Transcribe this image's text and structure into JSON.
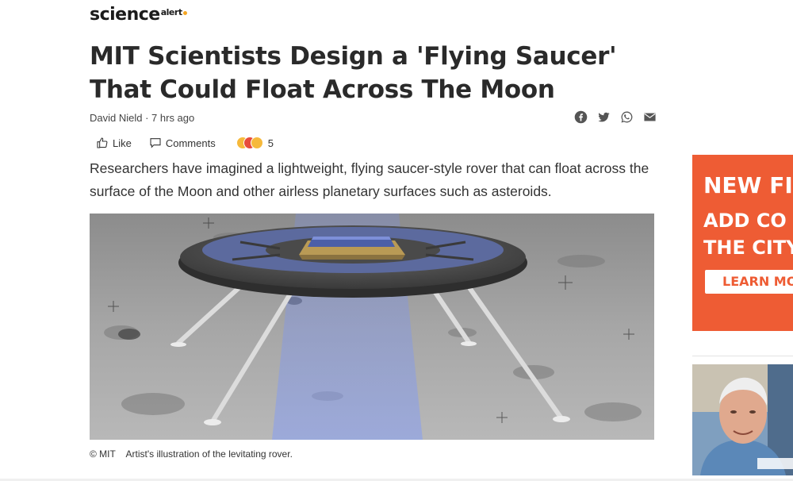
{
  "site": {
    "logo_main": "science",
    "logo_sup": "alert"
  },
  "article": {
    "title": "MIT Scientists Design a 'Flying Saucer' That Could Float Across The Moon",
    "author": "David Nield",
    "separator": " · ",
    "time": "7 hrs ago",
    "summary": "Researchers have imagined a lightweight, flying saucer-style rover that can float across the surface of the Moon and other airless planetary surfaces such as asteroids.",
    "caption_credit": "© MIT",
    "caption_text": "Artist's illustration of the levitating rover."
  },
  "share_icons": [
    "facebook-icon",
    "twitter-icon",
    "whatsapp-icon",
    "email-icon"
  ],
  "actions": {
    "like_label": "Like",
    "comments_label": "Comments",
    "reaction_count": "5",
    "reaction_colors": [
      "#f6b93b",
      "#e74c3c",
      "#f6b93b"
    ]
  },
  "ad": {
    "line1": "NEW FI",
    "line2": "ADD CO",
    "line3": "THE CITY",
    "button": "LEARN MO",
    "bg_color": "#ee5c34"
  }
}
